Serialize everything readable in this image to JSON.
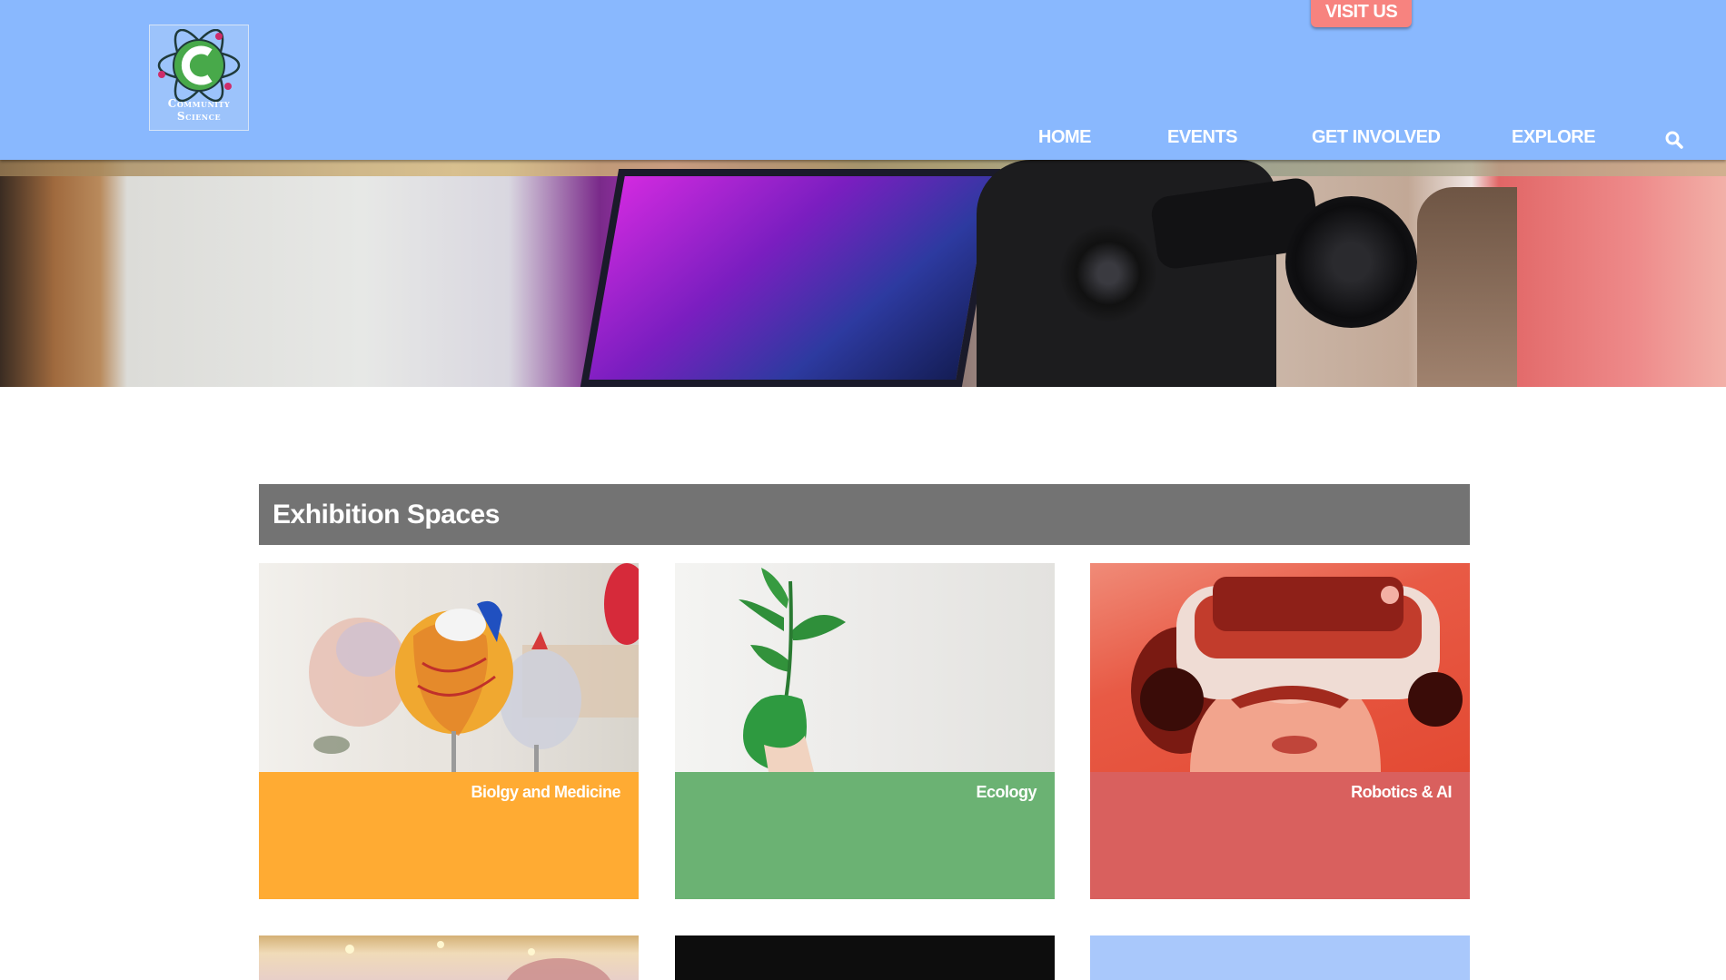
{
  "header": {
    "logo_line1": "Community",
    "logo_line2": "Science",
    "visit_label": "VISIT US",
    "nav": [
      {
        "label": "HOME"
      },
      {
        "label": "EVENTS"
      },
      {
        "label": "GET INVOLVED"
      },
      {
        "label": "EXPLORE"
      }
    ]
  },
  "section": {
    "title": "Exhibition Spaces",
    "cards": [
      {
        "label": "Biolgy and Medicine",
        "color": "#ffab33"
      },
      {
        "label": "Ecology",
        "color": "#6bb273"
      },
      {
        "label": "Robotics & AI",
        "color": "#d9605e"
      }
    ],
    "next_row_colors": [
      "#e8c9a0",
      "#0d0d0d",
      "#a9c8fb"
    ]
  },
  "icons": {
    "search": "search-icon",
    "logo": "atom-logo-icon"
  }
}
